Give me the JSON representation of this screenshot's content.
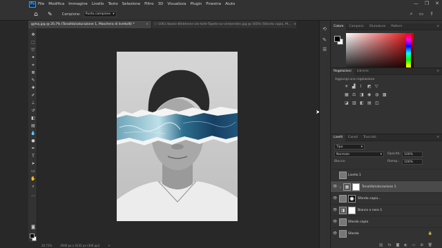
{
  "menubar": {
    "logo": "Ps",
    "items": [
      "File",
      "Modifica",
      "Immagine",
      "Livello",
      "Testo",
      "Selezione",
      "Filtro",
      "3D",
      "Visualizza",
      "Plugin",
      "Finestra",
      "Aiuto"
    ],
    "window_controls": [
      "—",
      "❐",
      "✕"
    ]
  },
  "optionsbar": {
    "sample_label": "Campione:",
    "sample_value": "Punto campione",
    "right_icons": [
      "search-icon",
      "workspace-icon",
      "share-icon"
    ]
  },
  "tabs": [
    {
      "label": "gyhoj.jpg @ 20,7% (Tonalità/saturazione 1, Maschera di livello/8) *",
      "close": "×"
    },
    {
      "label": "[--1061-8woto-80ddeenn-als-tolle-Tapete-zu-verwenden.jpg @ 165% (Sfondo copia, M...",
      "close": "×"
    }
  ],
  "status": {
    "zoom": "20,71%",
    "size": "2940 px x 4132 px (300 ppi)",
    "arrow": ">"
  },
  "panels": {
    "color_tabs": [
      "Colore",
      "Campioni",
      "Sfumature",
      "Pattern"
    ],
    "adjust_tabs": [
      "Regolazioni",
      "Librerie"
    ],
    "adjust_caption": "Aggiungi una regolazione",
    "layers_tabs": [
      "Livelli",
      "Canali",
      "Tracciati"
    ],
    "filter_label": "Tipo",
    "blend_mode": "Normale",
    "opacity_label": "Opacità:",
    "opacity_value": "100%",
    "lock_label": "Blocca:",
    "fill_label": "Riemp.:",
    "fill_value": "100%",
    "layers": [
      {
        "name": "Livello 1",
        "selected": false
      },
      {
        "name": "Tonalità/saturazione 1",
        "selected": true
      },
      {
        "name": "Sfondo copia...",
        "selected": false
      },
      {
        "name": "Bianco e nero 1",
        "selected": false
      },
      {
        "name": "Sfondo copia",
        "selected": false
      },
      {
        "name": "Sfondo",
        "selected": false
      }
    ]
  }
}
